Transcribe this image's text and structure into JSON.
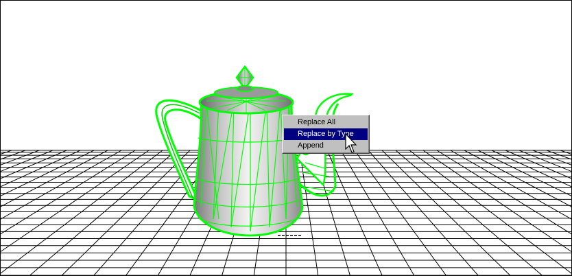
{
  "context_menu": {
    "items": [
      {
        "label": "Replace All"
      },
      {
        "label": "Replace by Type"
      },
      {
        "label": "Append"
      }
    ],
    "highlighted_index": 1
  },
  "colors": {
    "wireframe": "#00ff00",
    "grid": "#000000",
    "menu_highlight": "#000080",
    "menu_background": "#c0c0c0"
  }
}
